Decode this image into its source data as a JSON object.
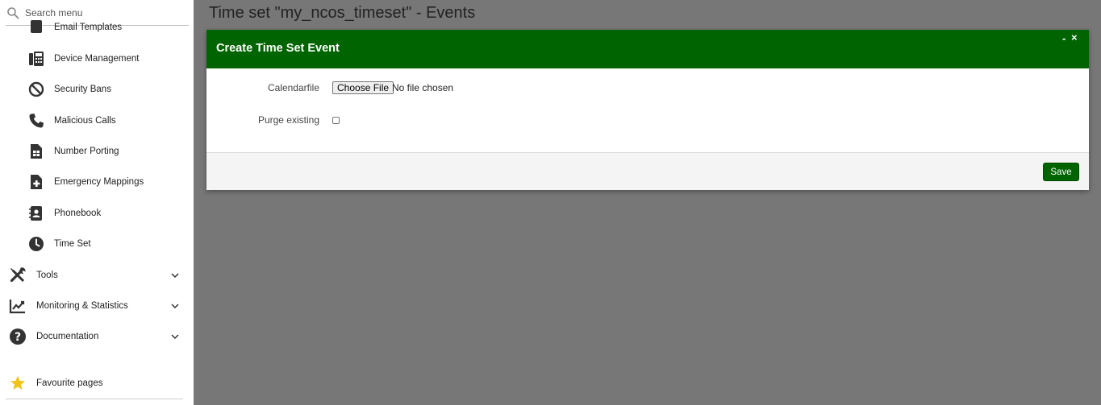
{
  "search": {
    "placeholder": "Search menu",
    "icon": "search-icon"
  },
  "sidebar": {
    "sub_items": [
      {
        "label": "Email Templates",
        "icon": "email-template-icon"
      },
      {
        "label": "Device Management",
        "icon": "device-management-icon"
      },
      {
        "label": "Security Bans",
        "icon": "ban-icon"
      },
      {
        "label": "Malicious Calls",
        "icon": "phone-icon"
      },
      {
        "label": "Number Porting",
        "icon": "sim-card-icon"
      },
      {
        "label": "Emergency Mappings",
        "icon": "file-medical-icon"
      },
      {
        "label": "Phonebook",
        "icon": "contact-book-icon"
      },
      {
        "label": "Time Set",
        "icon": "clock-icon"
      }
    ],
    "top_items": [
      {
        "label": "Tools",
        "icon": "tools-icon"
      },
      {
        "label": "Monitoring & Statistics",
        "icon": "chart-line-icon"
      },
      {
        "label": "Documentation",
        "icon": "help-icon"
      }
    ],
    "favourites": {
      "label": "Favourite pages",
      "icon": "star-icon"
    }
  },
  "page": {
    "title": "Time set \"my_ncos_timeset\" - Events"
  },
  "modal": {
    "title": "Create Time Set Event",
    "minimize": "-",
    "close": "×",
    "fields": {
      "calendarfile_label": "Calendarfile",
      "file_button": "Choose File",
      "file_status": "No file chosen",
      "purge_label": "Purge existing",
      "purge_checked": false
    },
    "save_label": "Save"
  },
  "colors": {
    "accent": "#006400",
    "backdrop": "#777777",
    "sidebar": "#ffffff",
    "star": "#f0c419"
  }
}
